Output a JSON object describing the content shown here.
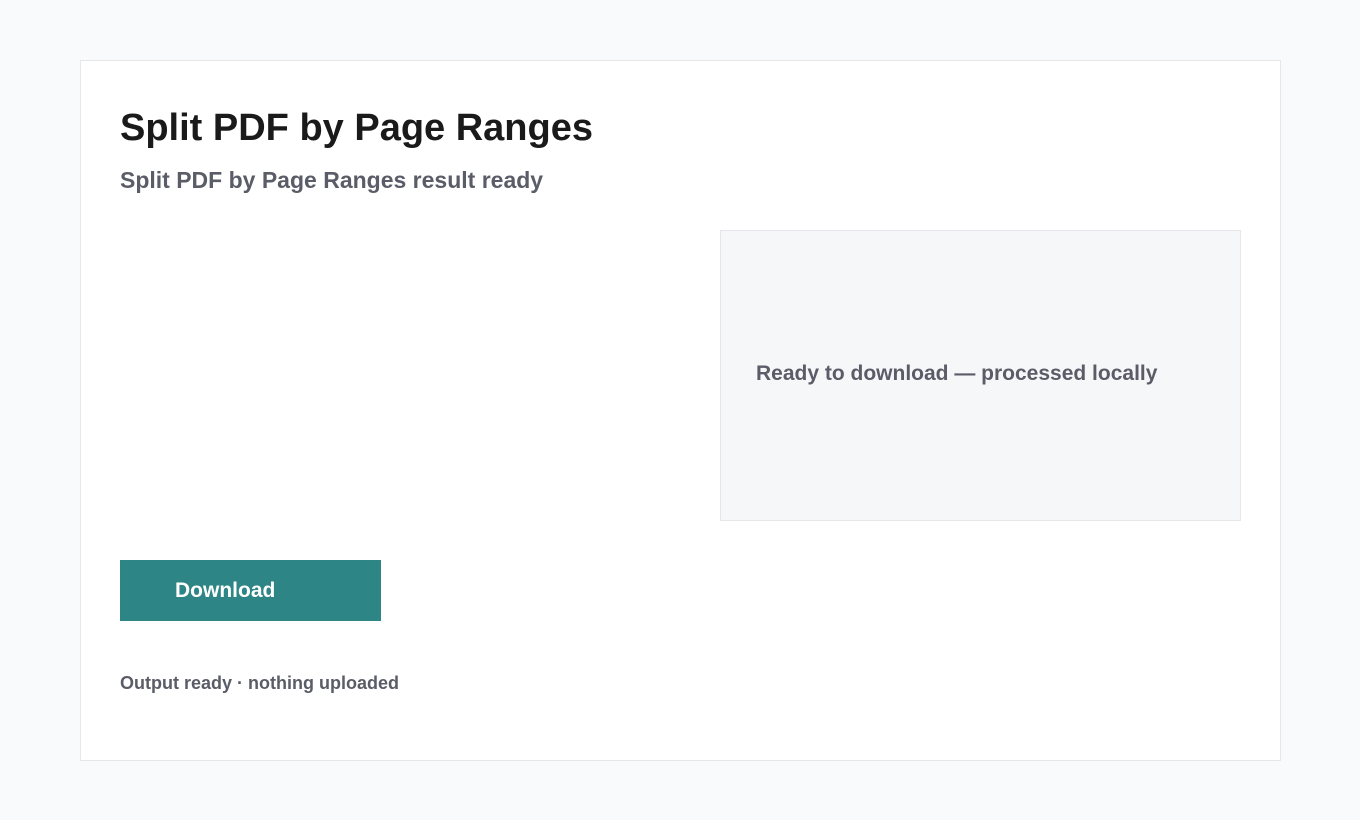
{
  "page": {
    "title": "Split PDF by Page Ranges",
    "subtitle": "Split PDF by Page Ranges result ready"
  },
  "status_panel": {
    "message": "Ready to download — processed locally"
  },
  "actions": {
    "download_label": "Download"
  },
  "footer": {
    "note": "Output ready · nothing uploaded"
  },
  "colors": {
    "accent": "#2d8585",
    "background": "#f9fafb",
    "card": "#ffffff",
    "panel": "#f6f7f8",
    "title_text": "#1a1a1a",
    "muted_text": "#5a5d68"
  }
}
